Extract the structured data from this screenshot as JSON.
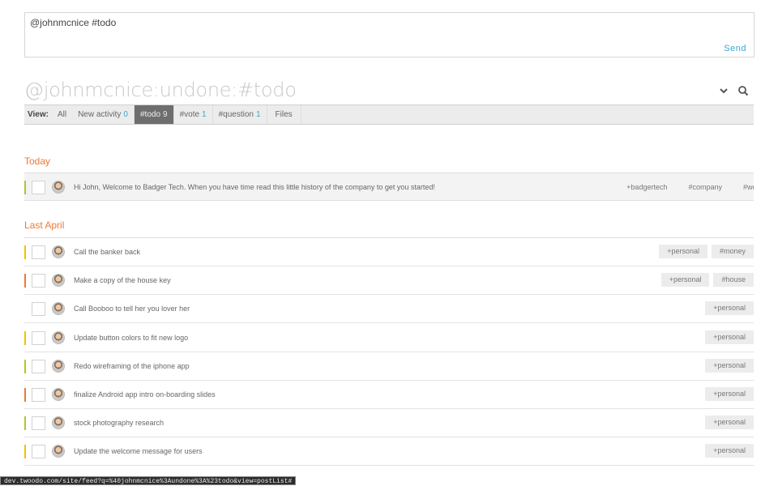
{
  "compose": {
    "text": "@johnmcnice #todo",
    "send_label": "Send"
  },
  "header": {
    "title": "@johnmcnice:undone:#todo",
    "icons": [
      "chevron-down-icon",
      "search-icon"
    ]
  },
  "viewbar": {
    "label": "View:",
    "tabs": [
      {
        "label": "All",
        "count": ""
      },
      {
        "label": "New activity",
        "count": "0"
      },
      {
        "label": "#todo",
        "count": "9",
        "active": true
      },
      {
        "label": "#vote",
        "count": "1"
      },
      {
        "label": "#question",
        "count": "1"
      },
      {
        "label": "Files",
        "count": ""
      }
    ]
  },
  "sections": {
    "today": {
      "title": "Today",
      "items": [
        {
          "text": "Hi John, Welcome to Badger Tech. When you have time read this little history of the company to get you started!",
          "priority_color": "#a8c832",
          "tags": [
            "+badgertech",
            "#company",
            "#we"
          ]
        }
      ]
    },
    "last_april": {
      "title": "Last April",
      "items": [
        {
          "text": "Call the banker back",
          "priority_color": "#f2c200",
          "tags": [
            "+personal",
            "#money"
          ]
        },
        {
          "text": "Make a copy of the house key",
          "priority_color": "#f07834",
          "tags": [
            "+personal",
            "#house"
          ]
        },
        {
          "text": "Call Booboo to tell her you lover her",
          "priority_color": "",
          "tags": [
            "+personal"
          ]
        },
        {
          "text": "Update button colors to fit new logo",
          "priority_color": "#f2c200",
          "tags": [
            "+personal"
          ]
        },
        {
          "text": "Redo wireframing of the iphone app",
          "priority_color": "#a8c832",
          "tags": [
            "+personal"
          ]
        },
        {
          "text": "finalize Android app intro on-boarding slides",
          "priority_color": "#f07834",
          "tags": [
            "+personal"
          ]
        },
        {
          "text": "stock photography research",
          "priority_color": "#a8c832",
          "tags": [
            "+personal"
          ]
        },
        {
          "text": "Update the welcome message for users",
          "priority_color": "#f2c200",
          "tags": [
            "+personal"
          ]
        }
      ]
    }
  },
  "statusbar": {
    "url": "dev.twoodo.com/site/feed?q=%40johnmcnice%3Aundone%3A%23todo&view=postList#"
  }
}
